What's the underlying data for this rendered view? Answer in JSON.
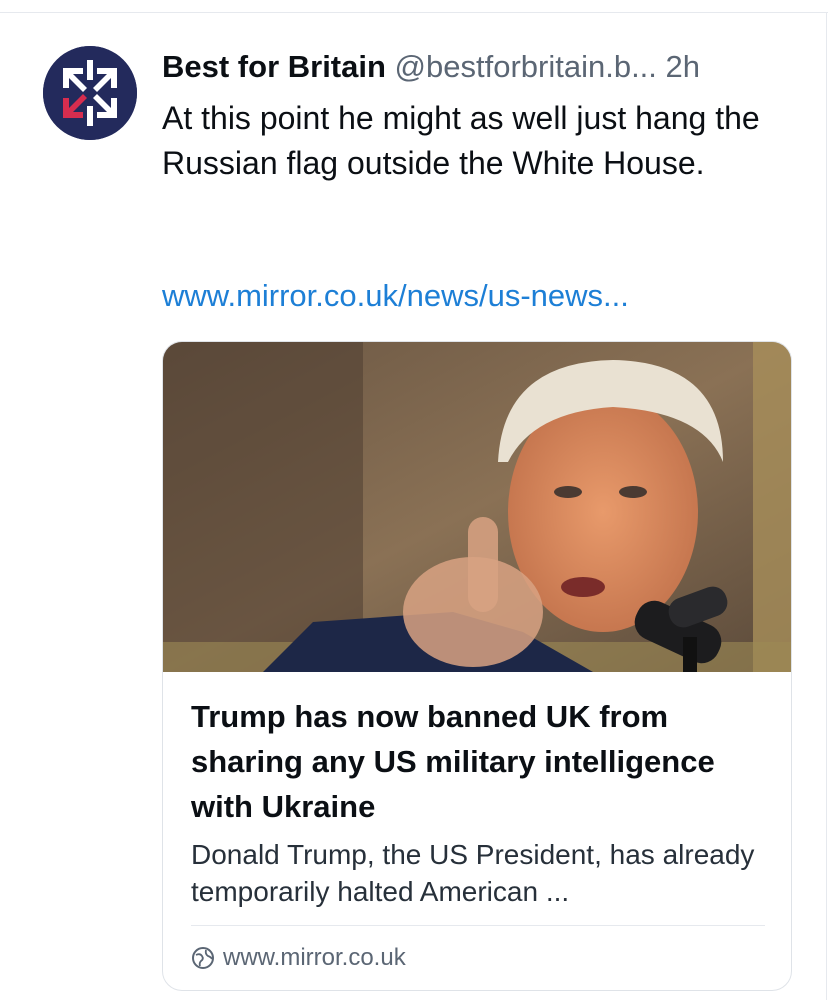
{
  "post": {
    "author_name": "Best for Britain",
    "handle": "@bestforbritain.b...",
    "timestamp": "2h",
    "text": "At this point he might as well just hang the Russian flag outside the White House.",
    "link_text": "www.mirror.co.uk/news/us-news..."
  },
  "avatar": {
    "icon": "best-for-britain-logo",
    "colors": {
      "background": "#232a5c",
      "arrows": "#ffffff",
      "accent": "#d62d4f"
    }
  },
  "link_card": {
    "image_alt": "Donald Trump pointing at the camera",
    "title": "Trump has now banned UK from sharing any US military intelligence with Ukraine",
    "description": "Donald Trump, the US President, has already temporarily halted American ...",
    "domain": "www.mirror.co.uk",
    "domain_icon": "globe-icon"
  },
  "colors": {
    "link": "#1d7fd6",
    "secondary_text": "#5b6674",
    "border": "#dfe3e8"
  }
}
